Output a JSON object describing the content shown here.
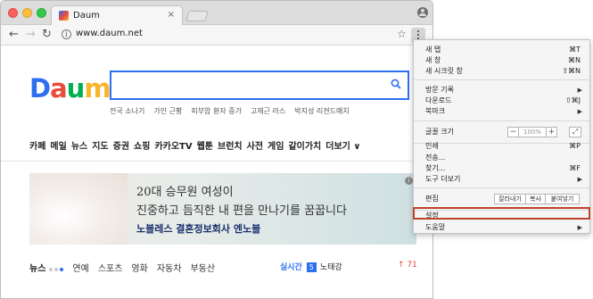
{
  "browser": {
    "tab_title": "Daum",
    "tab_close": "×",
    "url": "www.daum.net"
  },
  "page": {
    "logo": {
      "d": "D",
      "a": "a",
      "u": "u",
      "m": "m"
    },
    "trends": [
      "전국 소나기",
      "가인 근황",
      "피부암 환자 증가",
      "고재근 라스",
      "박지성 리젼드매치"
    ],
    "nav": [
      "카페",
      "메일",
      "뉴스",
      "지도",
      "증권",
      "쇼핑",
      "카카오TV",
      "웹툰",
      "브런치",
      "사전",
      "게임",
      "같이가치",
      "더보기 ∨"
    ],
    "banner": {
      "line1": "20대 승무원 여성이",
      "line2": "진중하고 듬직한 내 편을 만나기를 꿈꿉니다",
      "line3": "노블레스 결혼정보회사 엔노블"
    },
    "news_tabs": [
      "뉴스",
      "연예",
      "스포츠",
      "영화",
      "자동차",
      "부동산"
    ],
    "realtime_label": "실시간",
    "realtime_rank": "5",
    "realtime_item": "노태강",
    "trend_value": "↑ 71"
  },
  "menu": {
    "new_tab": {
      "label": "새 탭",
      "shortcut": "⌘T"
    },
    "new_window": {
      "label": "새 창",
      "shortcut": "⌘N"
    },
    "new_incognito": {
      "label": "새 시크릿 창",
      "shortcut": "⇧⌘N"
    },
    "history": {
      "label": "방문 기록"
    },
    "downloads": {
      "label": "다운로드",
      "shortcut": "⇧⌘J"
    },
    "bookmarks": {
      "label": "북마크"
    },
    "zoom": {
      "label": "글꼴 크기",
      "minus": "−",
      "value": "100%",
      "plus": "+",
      "fullscreen": "⤢"
    },
    "print": {
      "label": "인쇄",
      "shortcut": "⌘P"
    },
    "cast": {
      "label": "전송..."
    },
    "find": {
      "label": "찾기...",
      "shortcut": "⌘F"
    },
    "more_tools": {
      "label": "도구 더보기"
    },
    "edit": {
      "label": "편집",
      "cut": "잘라내기",
      "copy": "복사",
      "paste": "붙여넣기"
    },
    "settings": {
      "label": "설정"
    },
    "help": {
      "label": "도움말"
    },
    "arrow": "▶"
  },
  "colors": {
    "highlight": "#c0432e",
    "accent": "#2e6ff2"
  }
}
